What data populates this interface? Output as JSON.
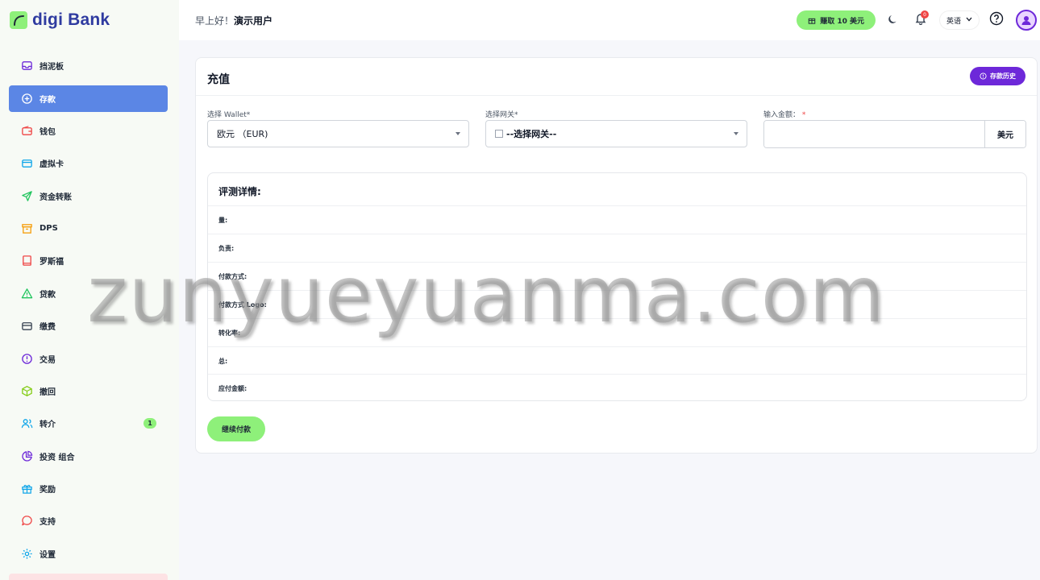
{
  "brand": {
    "name": "digi Bank",
    "accent": "#8ef07a",
    "primary": "#2f3ba0"
  },
  "header": {
    "greeting_prefix": "早上好！",
    "user_name": "演示用户",
    "earn_label": "赚取 10 美元",
    "notification_count": "0",
    "language": "英语",
    "icons": [
      "gift-icon",
      "moon-icon",
      "bell-icon",
      "chevron-down-icon",
      "help-icon",
      "user-avatar-icon"
    ]
  },
  "sidebar": {
    "active_color": "#5b86e5",
    "items": [
      {
        "label": "挡泥板",
        "icon": "inbox-icon"
      },
      {
        "label": "存款",
        "icon": "plus-circle-icon",
        "active": true
      },
      {
        "label": "钱包",
        "icon": "wallet-icon"
      },
      {
        "label": "虚拟卡",
        "icon": "card-icon"
      },
      {
        "label": "资金转账",
        "icon": "send-icon"
      },
      {
        "label": "DPS",
        "icon": "archive-icon"
      },
      {
        "label": "罗斯福",
        "icon": "book-icon"
      },
      {
        "label": "贷款",
        "icon": "warning-icon"
      },
      {
        "label": "缴费",
        "icon": "credit-card-icon"
      },
      {
        "label": "交易",
        "icon": "alert-circle-icon"
      },
      {
        "label": "撤回",
        "icon": "box-icon"
      },
      {
        "label": "转介",
        "icon": "users-icon",
        "badge": "1"
      },
      {
        "label": "投资 组合",
        "icon": "pie-chart-icon"
      },
      {
        "label": "奖励",
        "icon": "gift-icon"
      },
      {
        "label": "支持",
        "icon": "message-icon"
      },
      {
        "label": "设置",
        "icon": "gear-icon"
      }
    ]
  },
  "deposit": {
    "title": "充值",
    "history_label": "存款历史",
    "wallet_label": "选择 Wallet*",
    "wallet_value": "欧元 （EUR)",
    "gateway_label": "选择网关*",
    "gateway_value": "--选择网关--",
    "amount_label": "输入金额：",
    "amount_required": "*",
    "amount_value": "",
    "amount_unit": "美元",
    "details_title": "评测详情:",
    "details_rows": [
      "量:",
      "负责:",
      "付款方式:",
      "付款方式 Logo:",
      "转化率:",
      "总:",
      "应付金额:"
    ],
    "continue_label": "继续付款"
  },
  "watermark": "zunyueyuanma.com"
}
